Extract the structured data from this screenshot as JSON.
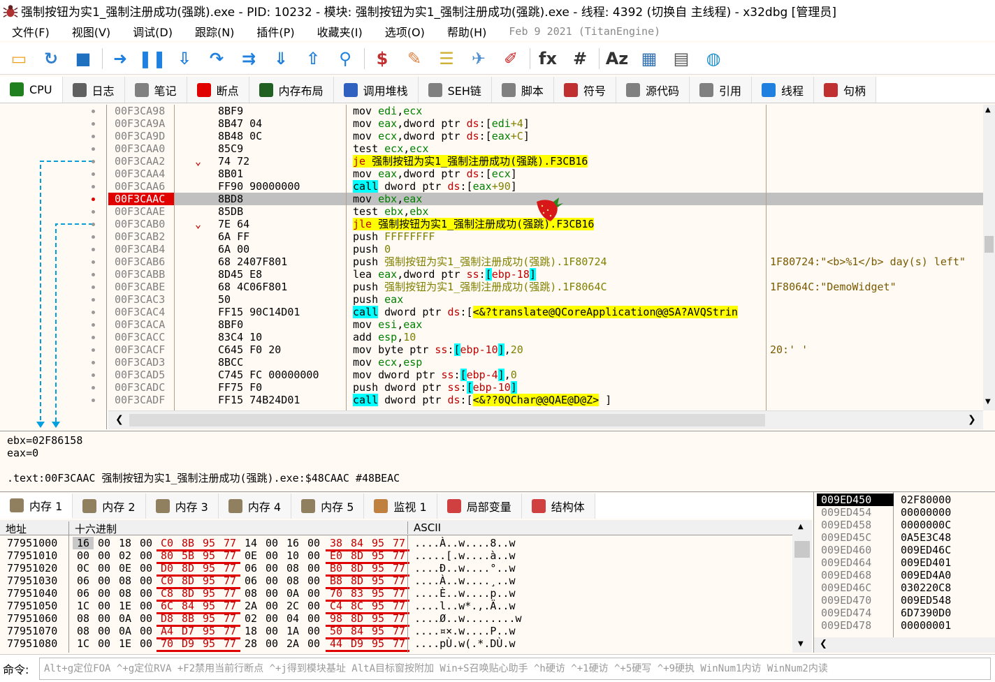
{
  "title": "强制按钮为实1_强制注册成功(强跳).exe - PID: 10232 - 模块: 强制按钮为实1_强制注册成功(强跳).exe - 线程: 4392 (切换自 主线程) - x32dbg [管理员]",
  "menu": [
    "文件(F)",
    "视图(V)",
    "调试(D)",
    "跟踪(N)",
    "插件(P)",
    "收藏夹(I)",
    "选项(O)",
    "帮助(H)"
  ],
  "menu_info": "Feb 9 2021 (TitanEngine)",
  "toolbar_icons": [
    "open-icon",
    "restart-icon",
    "stop-icon",
    "run-icon",
    "pause-icon",
    "step-into-icon",
    "step-over-icon",
    "trace-into-icon",
    "trace-over-icon",
    "execute-till-return-icon",
    "run-to-user-code-icon",
    "scylla-icon",
    "patch-icon",
    "comment-icon",
    "label-icon",
    "bookmark-icon",
    "function-icon",
    "hash-icon",
    "font-icon",
    "properties-icon",
    "calculator-icon",
    "globe-icon"
  ],
  "tabs": [
    {
      "label": "CPU",
      "icon": "cpu-icon"
    },
    {
      "label": "日志",
      "icon": "log-icon"
    },
    {
      "label": "笔记",
      "icon": "notes-icon"
    },
    {
      "label": "断点",
      "icon": "breakpoint-icon"
    },
    {
      "label": "内存布局",
      "icon": "memory-map-icon"
    },
    {
      "label": "调用堆栈",
      "icon": "call-stack-icon"
    },
    {
      "label": "SEH链",
      "icon": "seh-icon"
    },
    {
      "label": "脚本",
      "icon": "script-icon"
    },
    {
      "label": "符号",
      "icon": "symbols-icon"
    },
    {
      "label": "源代码",
      "icon": "source-icon"
    },
    {
      "label": "引用",
      "icon": "references-icon"
    },
    {
      "label": "线程",
      "icon": "threads-icon"
    },
    {
      "label": "句柄",
      "icon": "handles-icon"
    }
  ],
  "disasm": [
    {
      "addr": "00F3CA98",
      "bytes": "8BF9",
      "ins": [
        [
          "mov ",
          "mn"
        ],
        [
          "edi",
          "rg"
        ],
        [
          ",",
          "mn"
        ],
        [
          "ecx",
          "rg"
        ]
      ],
      "cmt": ""
    },
    {
      "addr": "00F3CA9A",
      "bytes": "8B47 04",
      "ins": [
        [
          "mov ",
          "mn"
        ],
        [
          "eax",
          "rg"
        ],
        [
          ",dword ptr ",
          "mn"
        ],
        [
          "ds",
          "sg"
        ],
        [
          ":[",
          "mn"
        ],
        [
          "edi",
          "rg"
        ],
        [
          "+4",
          "num"
        ],
        [
          "]",
          "mn"
        ]
      ],
      "cmt": ""
    },
    {
      "addr": "00F3CA9D",
      "bytes": "8B48 0C",
      "ins": [
        [
          "mov ",
          "mn"
        ],
        [
          "ecx",
          "rg"
        ],
        [
          ",dword ptr ",
          "mn"
        ],
        [
          "ds",
          "sg"
        ],
        [
          ":[",
          "mn"
        ],
        [
          "eax",
          "rg"
        ],
        [
          "+C",
          "num"
        ],
        [
          "]",
          "mn"
        ]
      ],
      "cmt": ""
    },
    {
      "addr": "00F3CAA0",
      "bytes": "85C9",
      "ins": [
        [
          "test ",
          "mn"
        ],
        [
          "ecx",
          "rg"
        ],
        [
          ",",
          "mn"
        ],
        [
          "ecx",
          "rg"
        ]
      ],
      "cmt": ""
    },
    {
      "addr": "00F3CAA2",
      "bytes": "74 72",
      "arrow": "v",
      "ins": [
        [
          "je",
          "sg yl"
        ],
        [
          " 强制按钮为实1_强制注册成功(强跳).F3CB16",
          "yl"
        ]
      ],
      "cmt": ""
    },
    {
      "addr": "00F3CAA4",
      "bytes": "8B01",
      "ins": [
        [
          "mov ",
          "mn"
        ],
        [
          "eax",
          "rg"
        ],
        [
          ",dword ptr ",
          "mn"
        ],
        [
          "ds",
          "sg"
        ],
        [
          ":[",
          "mn"
        ],
        [
          "ecx",
          "rg"
        ],
        [
          "]",
          "mn"
        ]
      ],
      "cmt": ""
    },
    {
      "addr": "00F3CAA6",
      "bytes": "FF90 90000000",
      "ins": [
        [
          "call",
          "cy"
        ],
        [
          " dword ptr ",
          "mn"
        ],
        [
          "ds",
          "sg"
        ],
        [
          ":[",
          "mn"
        ],
        [
          "eax",
          "rg"
        ],
        [
          "+90",
          "num"
        ],
        [
          "]",
          "mn"
        ]
      ],
      "cmt": ""
    },
    {
      "addr": "00F3CAAC",
      "bytes": "8BD8",
      "sel": true,
      "ins": [
        [
          "mov ",
          "mn"
        ],
        [
          "ebx",
          "rg"
        ],
        [
          ",",
          "mn"
        ],
        [
          "eax",
          "rg"
        ]
      ],
      "cmt": ""
    },
    {
      "addr": "00F3CAAE",
      "bytes": "85DB",
      "ins": [
        [
          "test ",
          "mn"
        ],
        [
          "ebx",
          "rg"
        ],
        [
          ",",
          "mn"
        ],
        [
          "ebx",
          "rg"
        ]
      ],
      "cmt": ""
    },
    {
      "addr": "00F3CAB0",
      "bytes": "7E 64",
      "arrow": "v",
      "ins": [
        [
          "jle",
          "sg yl"
        ],
        [
          " 强制按钮为实1_强制注册成功(强跳).F3CB16",
          "yl"
        ]
      ],
      "cmt": ""
    },
    {
      "addr": "00F3CAB2",
      "bytes": "6A FF",
      "ins": [
        [
          "push ",
          "mn"
        ],
        [
          "FFFFFFFF",
          "num"
        ]
      ],
      "cmt": ""
    },
    {
      "addr": "00F3CAB4",
      "bytes": "6A 00",
      "ins": [
        [
          "push ",
          "mn"
        ],
        [
          "0",
          "num"
        ]
      ],
      "cmt": ""
    },
    {
      "addr": "00F3CAB6",
      "bytes": "68 2407F801",
      "ins": [
        [
          "push ",
          "mn"
        ],
        [
          "强制按钮为实1_强制注册成功(强跳).1F80724",
          "lbl"
        ]
      ],
      "cmt": "1F80724:\"<b>%1</b> day(s) left\""
    },
    {
      "addr": "00F3CABB",
      "bytes": "8D45 E8",
      "ins": [
        [
          "lea ",
          "mn"
        ],
        [
          "eax",
          "rg"
        ],
        [
          ",dword ptr ",
          "mn"
        ],
        [
          "ss",
          "sg"
        ],
        [
          ":",
          "mn"
        ],
        [
          "[",
          "cy"
        ],
        [
          "ebp-18",
          "sg"
        ],
        [
          "]",
          "cy"
        ]
      ],
      "cmt": ""
    },
    {
      "addr": "00F3CABE",
      "bytes": "68 4C06F801",
      "ins": [
        [
          "push ",
          "mn"
        ],
        [
          "强制按钮为实1_强制注册成功(强跳).1F8064C",
          "lbl"
        ]
      ],
      "cmt": "1F8064C:\"DemoWidget\""
    },
    {
      "addr": "00F3CAC3",
      "bytes": "50",
      "ins": [
        [
          "push ",
          "mn"
        ],
        [
          "eax",
          "rg"
        ]
      ],
      "cmt": ""
    },
    {
      "addr": "00F3CAC4",
      "bytes": "FF15 90C14D01",
      "ins": [
        [
          "call",
          "cy"
        ],
        [
          " dword ptr ",
          "mn"
        ],
        [
          "ds",
          "sg"
        ],
        [
          ":[",
          "mn"
        ],
        [
          "<&?translate@QCoreApplication@@SA?AVQStrin",
          "yl"
        ]
      ],
      "cmt": ""
    },
    {
      "addr": "00F3CACA",
      "bytes": "8BF0",
      "ins": [
        [
          "mov ",
          "mn"
        ],
        [
          "esi",
          "rg"
        ],
        [
          ",",
          "mn"
        ],
        [
          "eax",
          "rg"
        ]
      ],
      "cmt": ""
    },
    {
      "addr": "00F3CACC",
      "bytes": "83C4 10",
      "ins": [
        [
          "add ",
          "mn"
        ],
        [
          "esp",
          "rg"
        ],
        [
          ",",
          "mn"
        ],
        [
          "10",
          "num"
        ]
      ],
      "cmt": ""
    },
    {
      "addr": "00F3CACF",
      "bytes": "C645 F0 20",
      "ins": [
        [
          "mov byte ptr ",
          "mn"
        ],
        [
          "ss",
          "sg"
        ],
        [
          ":",
          "mn"
        ],
        [
          "[",
          "cy"
        ],
        [
          "ebp-10",
          "sg"
        ],
        [
          "]",
          "cy"
        ],
        [
          ",",
          "mn"
        ],
        [
          "20",
          "num"
        ]
      ],
      "cmt": "20:' '"
    },
    {
      "addr": "00F3CAD3",
      "bytes": "8BCC",
      "ins": [
        [
          "mov ",
          "mn"
        ],
        [
          "ecx",
          "rg"
        ],
        [
          ",",
          "mn"
        ],
        [
          "esp",
          "rg"
        ]
      ],
      "cmt": ""
    },
    {
      "addr": "00F3CAD5",
      "bytes": "C745 FC 00000000",
      "ins": [
        [
          "mov dword ptr ",
          "mn"
        ],
        [
          "ss",
          "sg"
        ],
        [
          ":",
          "mn"
        ],
        [
          "[",
          "cy"
        ],
        [
          "ebp-4",
          "sg"
        ],
        [
          "]",
          "cy"
        ],
        [
          ",",
          "mn"
        ],
        [
          "0",
          "num"
        ]
      ],
      "cmt": ""
    },
    {
      "addr": "00F3CADC",
      "bytes": "FF75 F0",
      "ins": [
        [
          "push dword ptr ",
          "mn"
        ],
        [
          "ss",
          "sg"
        ],
        [
          ":",
          "mn"
        ],
        [
          "[",
          "cy"
        ],
        [
          "ebp-10",
          "sg"
        ],
        [
          "]",
          "cy"
        ]
      ],
      "cmt": ""
    },
    {
      "addr": "00F3CADF",
      "bytes": "FF15 74B24D01",
      "ins": [
        [
          "call",
          "cy"
        ],
        [
          " dword ptr ",
          "mn"
        ],
        [
          "ds",
          "sg"
        ],
        [
          ":[",
          "mn"
        ],
        [
          "<&??0QChar@@QAE@D@Z>",
          "yl"
        ],
        [
          " ]",
          "mn"
        ]
      ],
      "cmt": ""
    }
  ],
  "info_lines": [
    "ebx=02F86158",
    "eax=0",
    "",
    ".text:00F3CAAC 强制按钮为实1_强制注册成功(强跳).exe:$48CAAC #48BEAC"
  ],
  "dump_tabs": [
    {
      "label": "内存 1",
      "icon": "memory-icon"
    },
    {
      "label": "内存 2",
      "icon": "memory-icon"
    },
    {
      "label": "内存 3",
      "icon": "memory-icon"
    },
    {
      "label": "内存 4",
      "icon": "memory-icon"
    },
    {
      "label": "内存 5",
      "icon": "memory-icon"
    },
    {
      "label": "监视 1",
      "icon": "watch-icon"
    },
    {
      "label": "局部变量",
      "icon": "locals-icon"
    },
    {
      "label": "结构体",
      "icon": "struct-icon"
    }
  ],
  "dump_headers": {
    "addr": "地址",
    "hex": "十六进制",
    "ascii": "ASCII"
  },
  "dump": [
    {
      "addr": "77951000",
      "hex": [
        "16",
        "00",
        "18",
        "00",
        "C0",
        "8B",
        "95",
        "77",
        "14",
        "00",
        "16",
        "00",
        "38",
        "84",
        "95",
        "77"
      ],
      "ascii": "....À..w....8..w"
    },
    {
      "addr": "77951010",
      "hex": [
        "00",
        "00",
        "02",
        "00",
        "80",
        "5B",
        "95",
        "77",
        "0E",
        "00",
        "10",
        "00",
        "E0",
        "8D",
        "95",
        "77"
      ],
      "ascii": ".....[.w....à..w"
    },
    {
      "addr": "77951020",
      "hex": [
        "0C",
        "00",
        "0E",
        "00",
        "D0",
        "8D",
        "95",
        "77",
        "06",
        "00",
        "08",
        "00",
        "B0",
        "8D",
        "95",
        "77"
      ],
      "ascii": "....Ð..w....°..w"
    },
    {
      "addr": "77951030",
      "hex": [
        "06",
        "00",
        "08",
        "00",
        "C0",
        "8D",
        "95",
        "77",
        "06",
        "00",
        "08",
        "00",
        "B8",
        "8D",
        "95",
        "77"
      ],
      "ascii": "....À..w....¸..w"
    },
    {
      "addr": "77951040",
      "hex": [
        "06",
        "00",
        "08",
        "00",
        "C8",
        "8D",
        "95",
        "77",
        "08",
        "00",
        "0A",
        "00",
        "70",
        "83",
        "95",
        "77"
      ],
      "ascii": "....È..w....p..w"
    },
    {
      "addr": "77951050",
      "hex": [
        "1C",
        "00",
        "1E",
        "00",
        "6C",
        "84",
        "95",
        "77",
        "2A",
        "00",
        "2C",
        "00",
        "C4",
        "8C",
        "95",
        "77"
      ],
      "ascii": "....l..w*.,.Ä..w"
    },
    {
      "addr": "77951060",
      "hex": [
        "08",
        "00",
        "0A",
        "00",
        "D8",
        "8B",
        "95",
        "77",
        "02",
        "00",
        "04",
        "00",
        "98",
        "8D",
        "95",
        "77"
      ],
      "ascii": "....Ø..w........w"
    },
    {
      "addr": "77951070",
      "hex": [
        "08",
        "00",
        "0A",
        "00",
        "A4",
        "D7",
        "95",
        "77",
        "18",
        "00",
        "1A",
        "00",
        "50",
        "84",
        "95",
        "77"
      ],
      "ascii": "....¤×.w....P..w"
    },
    {
      "addr": "77951080",
      "hex": [
        "1C",
        "00",
        "1E",
        "00",
        "70",
        "D9",
        "95",
        "77",
        "28",
        "00",
        "2A",
        "00",
        "44",
        "D9",
        "95",
        "77"
      ],
      "ascii": "....pÙ.w(.*.DÙ.w"
    }
  ],
  "stack": [
    {
      "addr": "009ED450",
      "val": "02F80000",
      "cur": true
    },
    {
      "addr": "009ED454",
      "val": "00000000"
    },
    {
      "addr": "009ED458",
      "val": "0000000C"
    },
    {
      "addr": "009ED45C",
      "val": "0A5E3C48"
    },
    {
      "addr": "009ED460",
      "val": "009ED46C"
    },
    {
      "addr": "009ED464",
      "val": "009ED401"
    },
    {
      "addr": "009ED468",
      "val": "009ED4A0"
    },
    {
      "addr": "009ED46C",
      "val": "030220C8"
    },
    {
      "addr": "009ED470",
      "val": "009ED548"
    },
    {
      "addr": "009ED474",
      "val": "6D7390D0"
    },
    {
      "addr": "009ED478",
      "val": "00000001"
    }
  ],
  "cmd": {
    "label": "命令:",
    "placeholder": "Alt+g定位FOA ^+g定位RVA +F2禁用当前行断点 ^+j得到模块基址 AltA目标窗按附加 Win+S召唤贴心助手 ^h硬访 ^+1硬访 ^+5硬写 ^+9硬执 WinNum1内访 WinNum2内读"
  },
  "colors": {
    "selected_address_bg": "#e00000",
    "highlight_yellow": "#ffff00",
    "highlight_cyan": "#00ffff",
    "register_green": "#008000",
    "segment_red": "#c00000"
  }
}
